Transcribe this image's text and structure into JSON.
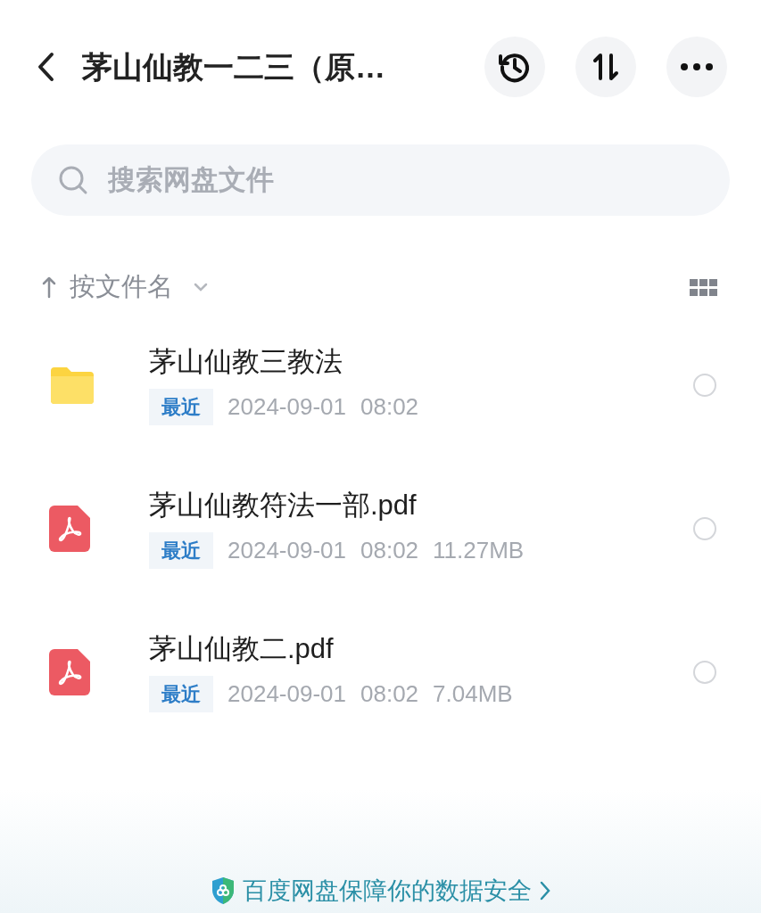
{
  "header": {
    "title": "茅山仙教一二三（原…"
  },
  "search": {
    "placeholder": "搜索网盘文件"
  },
  "sort": {
    "label": "按文件名"
  },
  "files": [
    {
      "kind": "folder",
      "name": "茅山仙教三教法",
      "tag": "最近",
      "date": "2024-09-01",
      "time": "08:02",
      "selected": false
    },
    {
      "kind": "pdf",
      "name": "茅山仙教符法一部.pdf",
      "tag": "最近",
      "date": "2024-09-01",
      "time": "08:02",
      "size": "11.27MB",
      "selected": false
    },
    {
      "kind": "pdf",
      "name": "茅山仙教二.pdf",
      "tag": "最近",
      "date": "2024-09-01",
      "time": "08:02",
      "size": "7.04MB",
      "selected": false
    }
  ],
  "footer": {
    "text": "百度网盘保障你的数据安全"
  }
}
